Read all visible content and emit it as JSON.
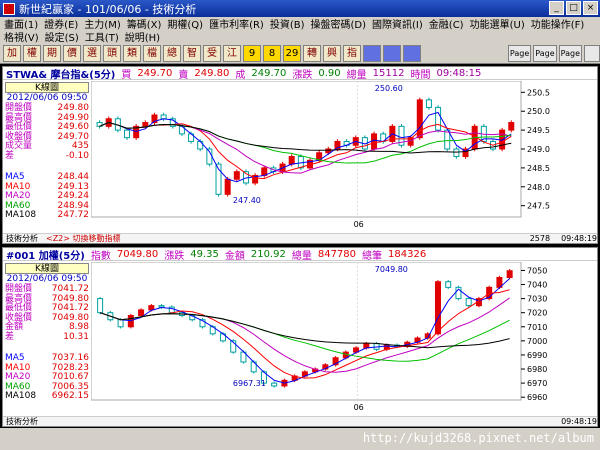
{
  "window": {
    "title": "新世紀贏家 - 101/06/06 - 技術分析"
  },
  "menu": {
    "row1": [
      "畫面(1)",
      "證券(E)",
      "主力(M)",
      "籌碼(X)",
      "期權(Q)",
      "匯市利率(R)",
      "投資(B)",
      "操盤密碼(D)",
      "國際資訊(I)",
      "金融(C)",
      "功能選單(U)",
      "功能操作(F)"
    ],
    "row2": [
      "格視(V)",
      "設定(S)",
      "工具(T)",
      "說明(H)"
    ]
  },
  "toolbar": {
    "buttons": [
      "加",
      "權",
      "期",
      "價",
      "選",
      "頭",
      "類",
      "檔",
      "總",
      "智",
      "受",
      "江",
      "9",
      "8",
      "29",
      "轉",
      "興",
      "指",
      "",
      "",
      ""
    ],
    "right_buttons": [
      "Page",
      "Page",
      "Page",
      ""
    ]
  },
  "panel1": {
    "symbol": "STWA& 摩台指&(5分)",
    "buy_label": "買",
    "buy": "249.70",
    "sell_label": "賣",
    "sell": "249.80",
    "deal_label": "成",
    "deal": "249.70",
    "change_label": "漲跌",
    "change": "0.90",
    "volume_label": "總量",
    "volume": "15112",
    "time_label": "時間",
    "time": "09:48:15",
    "k_title": "K線圖",
    "k_date": "2012/06/06 09:50",
    "rows": [
      {
        "n": "開盤價",
        "v": "249.80"
      },
      {
        "n": "最高價",
        "v": "249.90"
      },
      {
        "n": "最低價",
        "v": "249.60"
      },
      {
        "n": "收盤價",
        "v": "249.70"
      },
      {
        "n": "成交量",
        "v": "435"
      },
      {
        "n": "差",
        "v": "-0.10"
      }
    ],
    "ma": [
      {
        "n": "MA5",
        "v": "248.44"
      },
      {
        "n": "MA10",
        "v": "249.13"
      },
      {
        "n": "MA20",
        "v": "249.24"
      },
      {
        "n": "MA60",
        "v": "248.94"
      },
      {
        "n": "MA108",
        "v": "247.72"
      }
    ],
    "high_mark": "250.60",
    "low_mark": "247.40",
    "date_mark": "06",
    "yticks": [
      "250.5",
      "250.0",
      "249.5",
      "249.0",
      "248.5",
      "248.0",
      "247.5"
    ],
    "foot_left": "技術分析",
    "foot_mid": "<Z2> 切換移動指標",
    "foot_count": "2578",
    "foot_time": "09:48:19"
  },
  "panel2": {
    "symbol": "#001 加權(5分)",
    "index_label": "指數",
    "index": "7049.80",
    "change_label": "漲跌",
    "change": "49.35",
    "amount_label": "金額",
    "amount": "210.92",
    "volume_label": "總量",
    "volume": "847780",
    "count_label": "總筆",
    "count": "184326",
    "k_title": "K線圖",
    "k_date": "2012/06/06 09:50",
    "rows": [
      {
        "n": "開盤價",
        "v": "7041.72"
      },
      {
        "n": "最高價",
        "v": "7049.80"
      },
      {
        "n": "最低價",
        "v": "7041.72"
      },
      {
        "n": "收盤價",
        "v": "7049.80"
      },
      {
        "n": "金額",
        "v": "8.98"
      },
      {
        "n": "差",
        "v": "10.31"
      }
    ],
    "ma": [
      {
        "n": "MA5",
        "v": "7037.16"
      },
      {
        "n": "MA10",
        "v": "7028.23"
      },
      {
        "n": "MA20",
        "v": "7010.67"
      },
      {
        "n": "MA60",
        "v": "7006.35"
      },
      {
        "n": "MA108",
        "v": "6962.15"
      }
    ],
    "high_mark": "7049.80",
    "low_mark": "6967.31",
    "date_mark": "06",
    "yticks": [
      "7050",
      "7040",
      "7030",
      "7020",
      "7010",
      "7000",
      "6990",
      "6980",
      "6970",
      "6960"
    ],
    "foot_left": "技術分析",
    "foot_count": "",
    "foot_time": "09:48:19"
  },
  "status": {
    "left": "",
    "watermark": "http://kujd3268.pixnet.net/album"
  },
  "colors": {
    "up": "#e00000",
    "down": "#00a0a0",
    "ma5": "#0000ff",
    "ma10": "#ff0000",
    "ma20": "#c000c0",
    "ma60": "#00c000",
    "ma108": "#000000"
  }
}
